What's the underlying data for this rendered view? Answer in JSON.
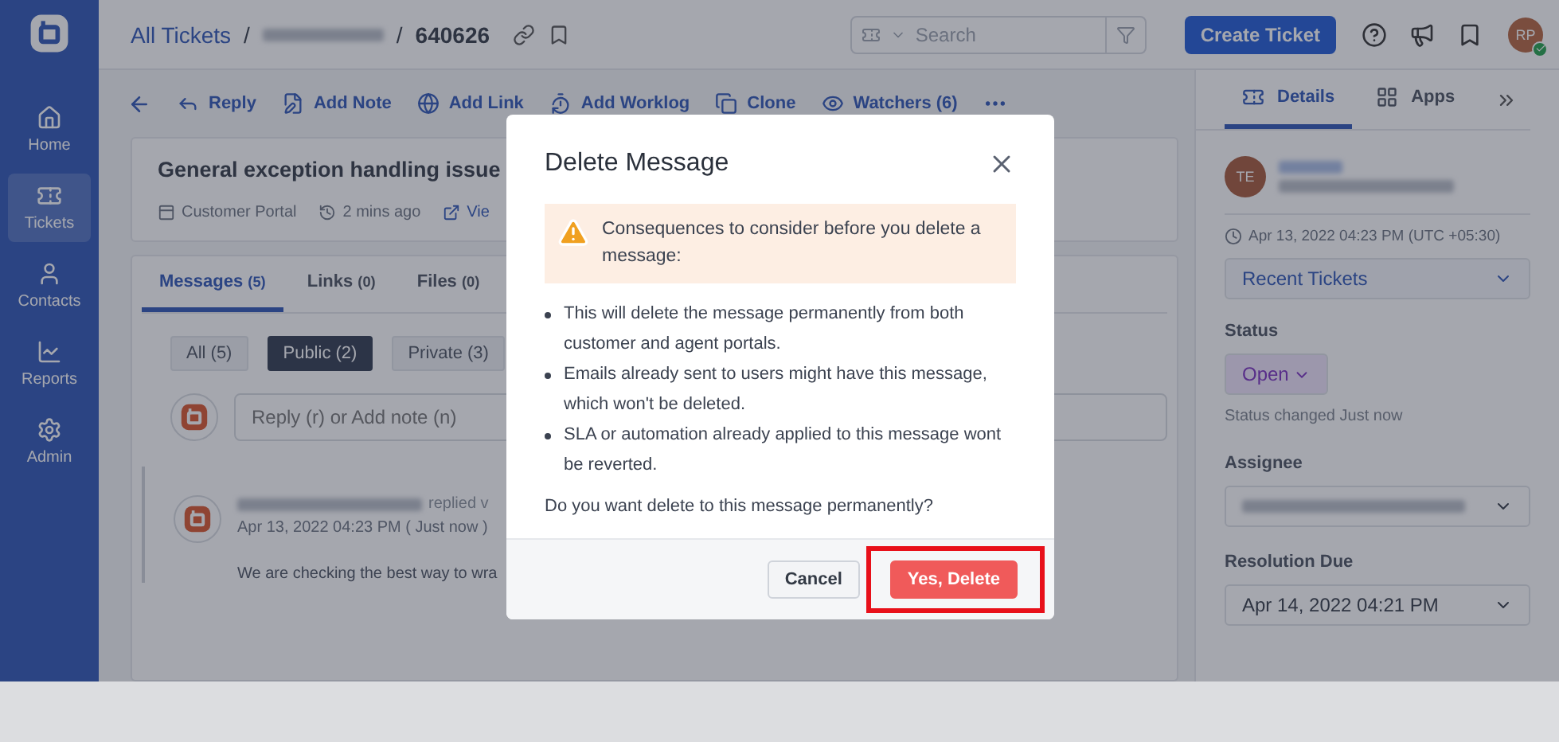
{
  "nav": [
    {
      "label": "Home",
      "selected": false
    },
    {
      "label": "Tickets",
      "selected": true
    },
    {
      "label": "Contacts",
      "selected": false
    },
    {
      "label": "Reports",
      "selected": false
    },
    {
      "label": "Admin",
      "selected": false
    }
  ],
  "header": {
    "breadcrumb_root": "All Tickets",
    "separator_1": "/",
    "separator_2": "/",
    "ticket_id": "640626",
    "search": {
      "placeholder": "Search"
    },
    "create_button": "Create Ticket",
    "avatar": {
      "initials": "RP",
      "online": true
    }
  },
  "toolbar": {
    "actions": [
      "Reply",
      "Add Note",
      "Add Link",
      "Add Worklog",
      "Clone",
      "Watchers (6)"
    ]
  },
  "ticket": {
    "title": "General exception handling issue",
    "meta": [
      "Customer Portal",
      "2 mins ago",
      "Vie"
    ]
  },
  "tabs": [
    {
      "label": "Messages",
      "count": "(5)",
      "selected": true
    },
    {
      "label": "Links",
      "count": "(0)",
      "selected": false
    },
    {
      "label": "Files",
      "count": "(0)",
      "selected": false
    }
  ],
  "filters": [
    {
      "label": "All (5)",
      "selected": false
    },
    {
      "label": "Public (2)",
      "selected": true
    },
    {
      "label": "Private (3)",
      "selected": false
    }
  ],
  "composer": {
    "placeholder": "Reply (r) or Add note (n)"
  },
  "message": {
    "action": "replied v",
    "date": "Apr 13, 2022 04:23 PM ( Just now )",
    "body": "We are checking the best way to wra"
  },
  "details": {
    "tabs": [
      {
        "label": "Details",
        "selected": true
      },
      {
        "label": "Apps",
        "selected": false
      }
    ],
    "contact_initials": "TE",
    "created": "Apr 13, 2022 04:23 PM (UTC +05:30)",
    "recent_tickets": "Recent Tickets",
    "status_label": "Status",
    "status": "Open",
    "status_note": "Status changed Just now",
    "assignee_label": "Assignee",
    "resolution_label": "Resolution Due",
    "resolution_due": "Apr 14, 2022 04:21 PM"
  },
  "modal": {
    "title": "Delete Message",
    "warning": "Consequences to consider before you delete a message:",
    "bullets": [
      "This will delete the message permanently from both customer and agent portals.",
      "Emails already sent to users might have this message, which won't be deleted.",
      "SLA or automation already applied to this message wont be reverted."
    ],
    "question": "Do you want delete to this message permanently?",
    "cancel": "Cancel",
    "confirm": "Yes, Delete",
    "confirm_highlighted": true
  }
}
